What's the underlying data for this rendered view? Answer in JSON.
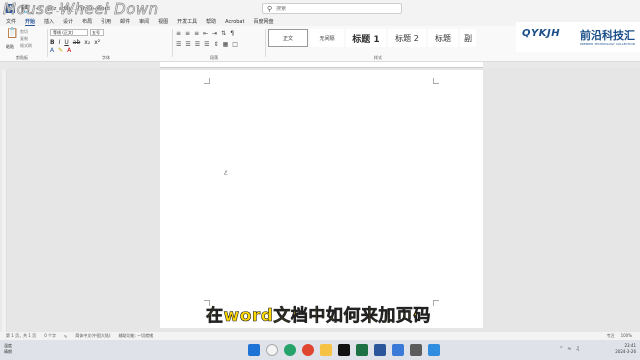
{
  "titlebar": {
    "title": "ydz_adas_...(索引) - Word",
    "search_placeholder": "搜索"
  },
  "tabs": [
    "文件",
    "开始",
    "插入",
    "设计",
    "布局",
    "引用",
    "邮件",
    "审阅",
    "视图",
    "开发工具",
    "帮助",
    "Acrobat",
    "百度网盘"
  ],
  "ribbon": {
    "paste_label": "粘贴",
    "cut": "剪切",
    "copy": "复制",
    "format_painter": "格式刷",
    "font_name": "等线 (正文)",
    "font_size": "五号",
    "group_clipboard": "剪贴板",
    "group_font": "字体",
    "group_paragraph": "段落",
    "group_styles": "样式",
    "styles": [
      "正文",
      "无间隔",
      "标题 1",
      "标题 2",
      "标题",
      "副"
    ]
  },
  "overlay": "Mouse Wheel Down",
  "logo": {
    "mark": "QYKJH",
    "cn": "前沿科技汇",
    "sub": "PREMIER TECHNOLOGY COLLECTION"
  },
  "subtitle": "在word文档中如何来加页码",
  "statusbar": {
    "page": "第 1 页，共 1 页",
    "words": "0 个字",
    "lang": "简体中文(中国大陆)",
    "accessibility": "辅助功能: 一切就绪",
    "focus": "专注",
    "zoom": "100%"
  },
  "taskbar": {
    "weather_temp": "温度",
    "weather_desc": "晴朗",
    "time": "23:41",
    "date": "2024-3-26"
  },
  "colors": {
    "word_blue": "#2b579a",
    "subtitle_yellow": "#ffd800",
    "logo_blue": "#1b4f8a"
  }
}
